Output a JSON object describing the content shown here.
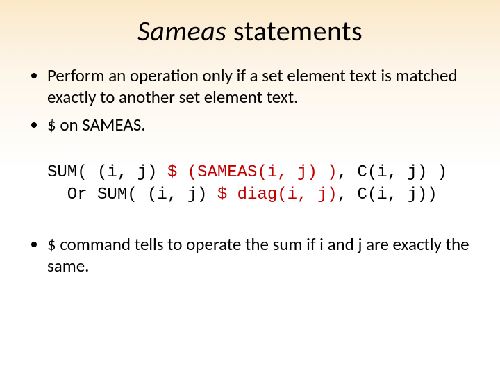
{
  "title_italic": "Sameas",
  "title_rest": " statements",
  "bullets_top": [
    "Perform an operation only if a set element text is matched exactly to another set element text.",
    "$ on SAMEAS."
  ],
  "code": {
    "line1_a": "SUM( (i, j) ",
    "line1_hl": "$ (SAMEAS(i, j) )",
    "line1_b": ", C(i, j) )",
    "line2_a": "  Or SUM( (i, j) ",
    "line2_hl": "$ diag(i, j)",
    "line2_b": ", C(i, j))"
  },
  "bullets_bottom": [
    "$ command tells to operate the sum if  i and j are exactly the same."
  ]
}
